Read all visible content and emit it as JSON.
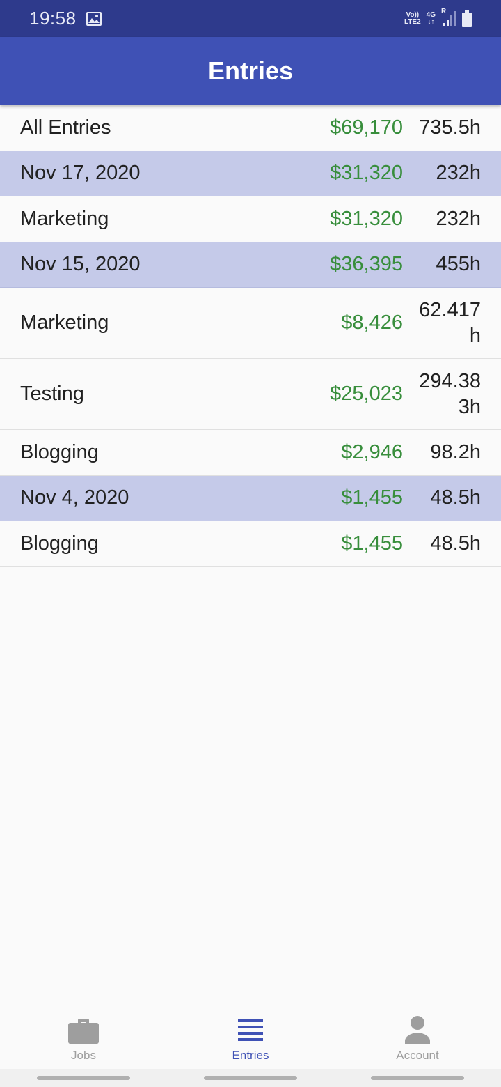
{
  "status_bar": {
    "time": "19:58",
    "volte_top": "Vo))",
    "volte_bottom": "LTE2",
    "network_top": "4G",
    "network_bottom": "↓↑",
    "roaming": "R"
  },
  "app_bar": {
    "title": "Entries"
  },
  "entries": [
    {
      "label": "All Entries",
      "amount": "$69,170",
      "hours": "735.5h",
      "kind": "summary"
    },
    {
      "label": "Nov 17, 2020",
      "amount": "$31,320",
      "hours": "232h",
      "kind": "date"
    },
    {
      "label": "Marketing",
      "amount": "$31,320",
      "hours": "232h",
      "kind": "job"
    },
    {
      "label": "Nov 15, 2020",
      "amount": "$36,395",
      "hours": "455h",
      "kind": "date"
    },
    {
      "label": "Marketing",
      "amount": "$8,426",
      "hours": "62.417h",
      "kind": "job"
    },
    {
      "label": "Testing",
      "amount": "$25,023",
      "hours": "294.383h",
      "kind": "job"
    },
    {
      "label": "Blogging",
      "amount": "$2,946",
      "hours": "98.2h",
      "kind": "job"
    },
    {
      "label": "Nov 4, 2020",
      "amount": "$1,455",
      "hours": "48.5h",
      "kind": "date"
    },
    {
      "label": "Blogging",
      "amount": "$1,455",
      "hours": "48.5h",
      "kind": "job"
    }
  ],
  "bottom_nav": {
    "items": [
      {
        "label": "Jobs",
        "icon": "briefcase-icon",
        "active": false
      },
      {
        "label": "Entries",
        "icon": "list-icon",
        "active": true
      },
      {
        "label": "Account",
        "icon": "person-icon",
        "active": false
      }
    ]
  },
  "colors": {
    "status_bar": "#2e3a8c",
    "app_bar": "#3f51b5",
    "date_row": "#c5cae9",
    "amount": "#388e3c",
    "nav_active": "#3f51b5",
    "nav_inactive": "#9e9e9e"
  }
}
